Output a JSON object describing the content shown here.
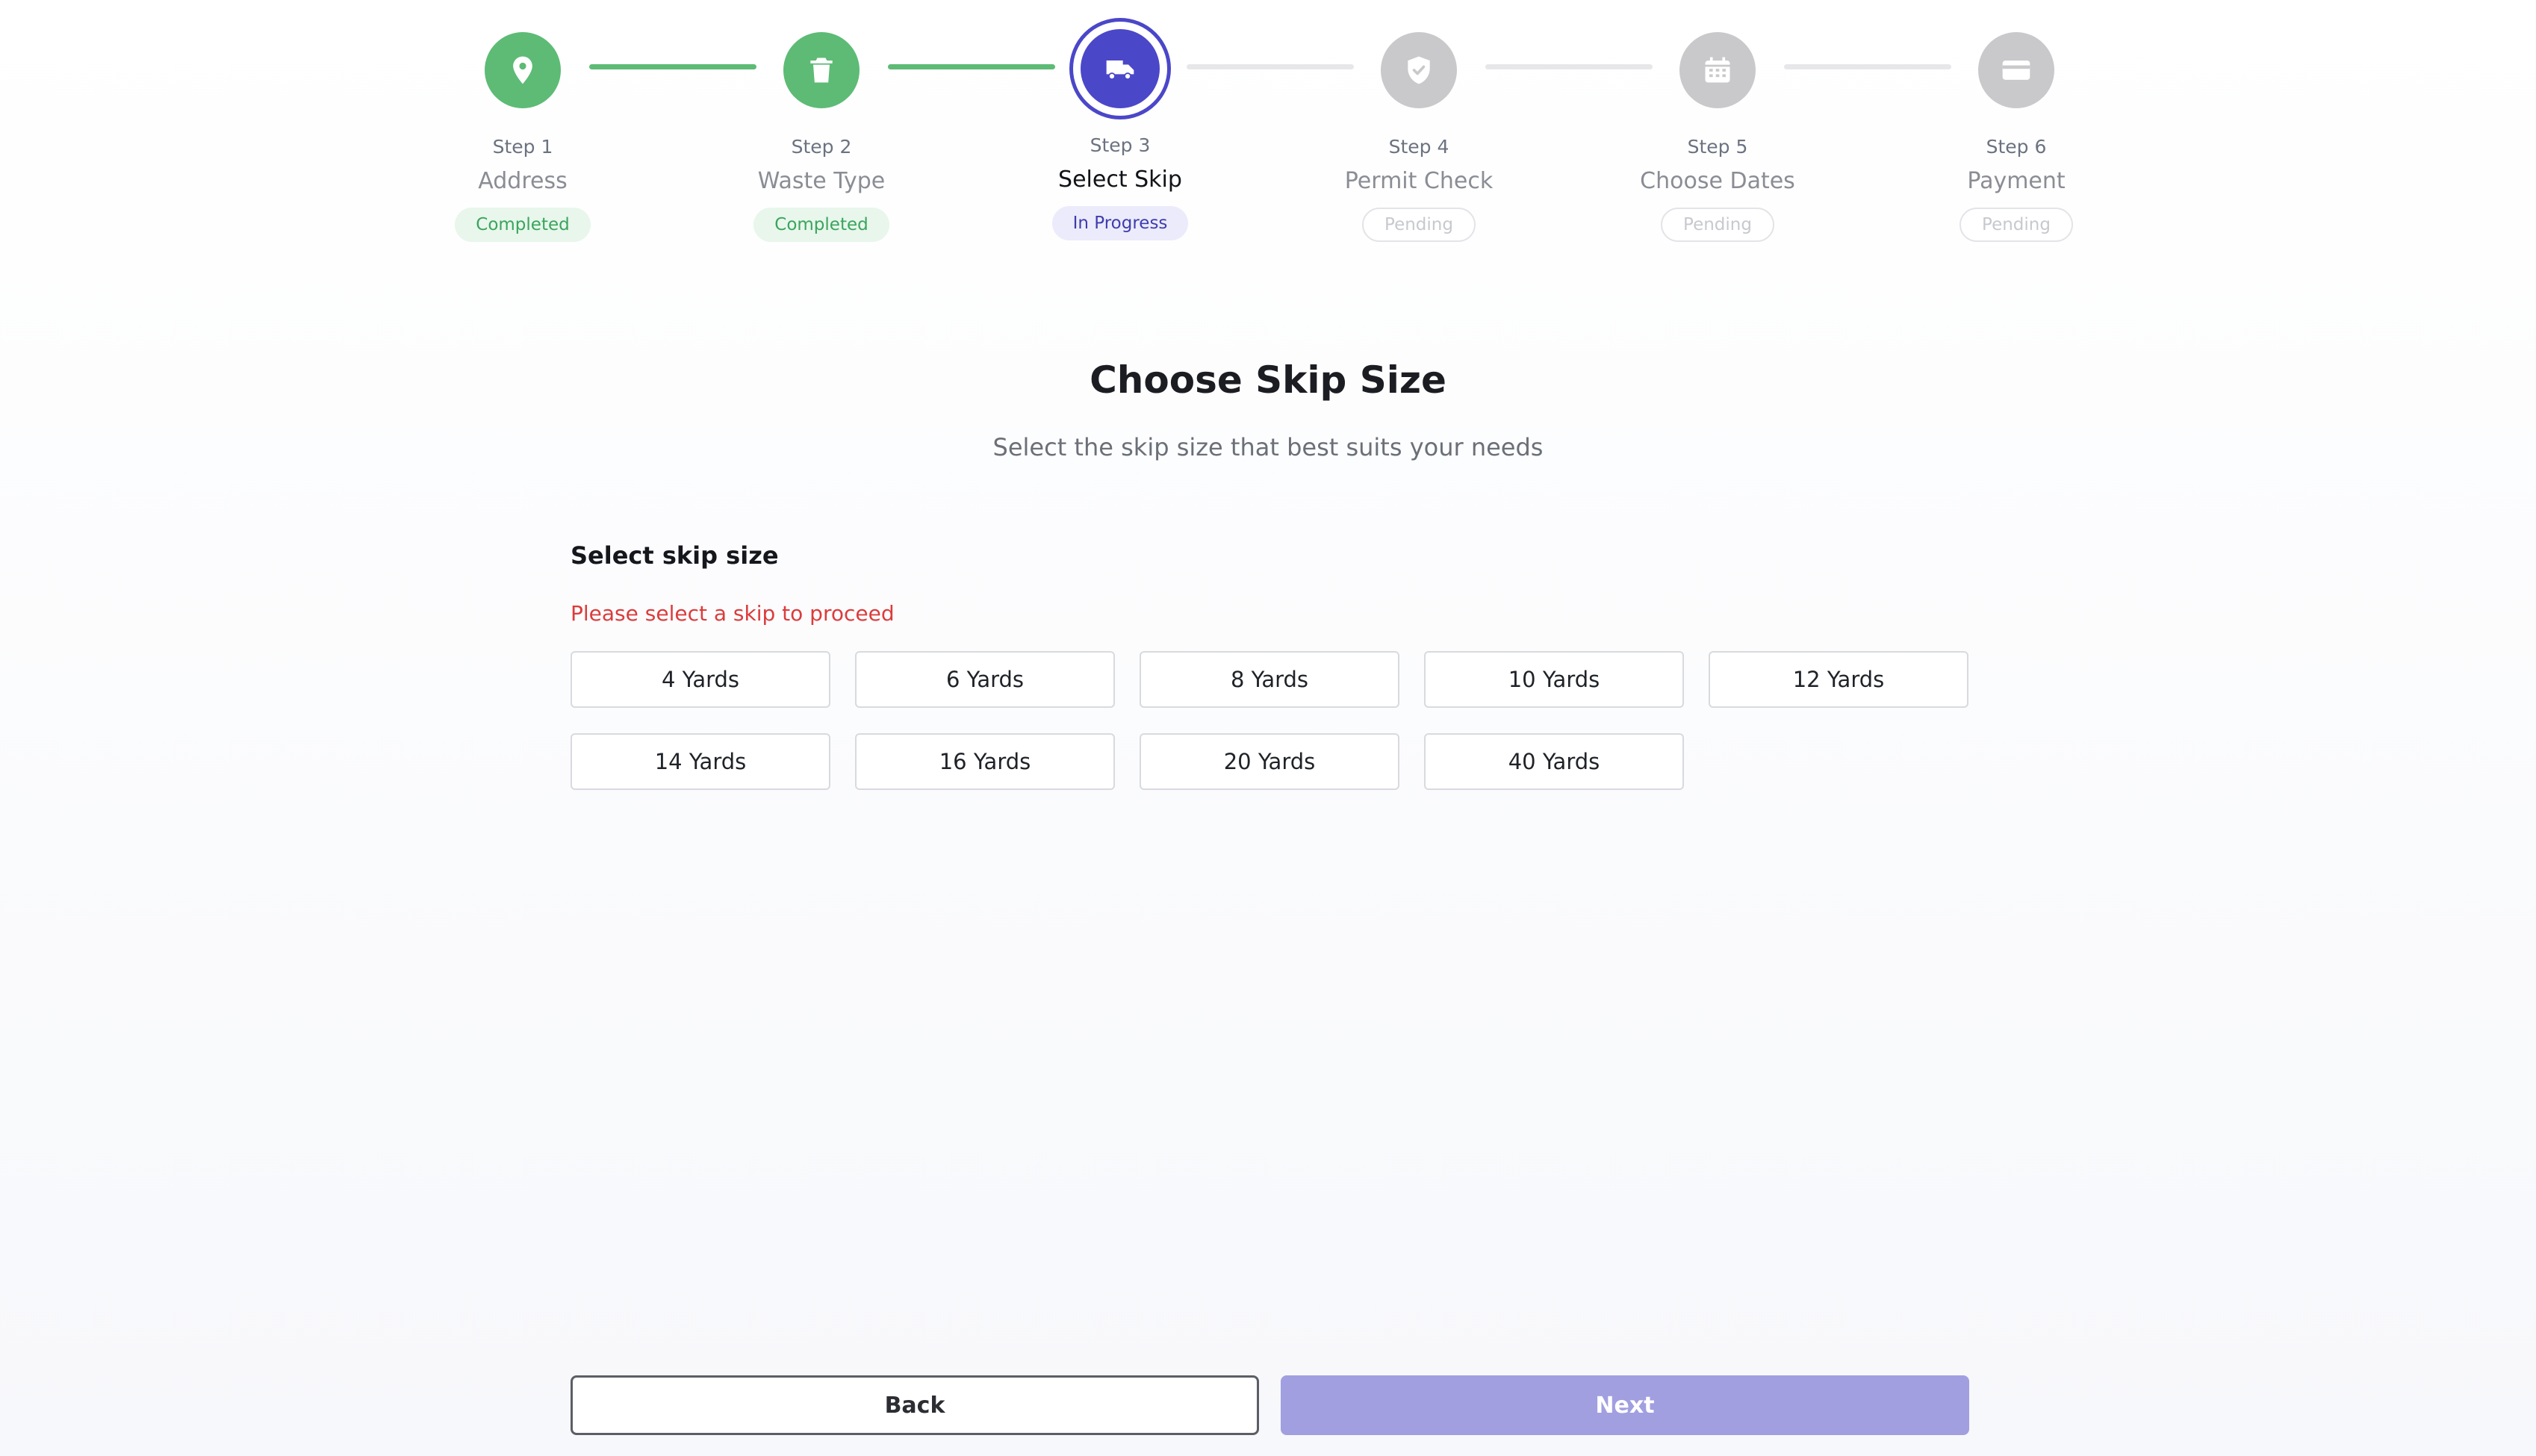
{
  "stepper": {
    "steps": [
      {
        "number": "Step 1",
        "name": "Address",
        "status": "Completed",
        "state": "completed",
        "icon": "map-pin-icon"
      },
      {
        "number": "Step 2",
        "name": "Waste Type",
        "status": "Completed",
        "state": "completed",
        "icon": "trash-icon"
      },
      {
        "number": "Step 3",
        "name": "Select Skip",
        "status": "In Progress",
        "state": "current",
        "icon": "truck-icon"
      },
      {
        "number": "Step 4",
        "name": "Permit Check",
        "status": "Pending",
        "state": "pending",
        "icon": "shield-check-icon"
      },
      {
        "number": "Step 5",
        "name": "Choose Dates",
        "status": "Pending",
        "state": "pending",
        "icon": "calendar-icon"
      },
      {
        "number": "Step 6",
        "name": "Payment",
        "status": "Pending",
        "state": "pending",
        "icon": "credit-card-icon"
      }
    ]
  },
  "header": {
    "title": "Choose Skip Size",
    "subtitle": "Select the skip size that best suits your needs"
  },
  "skip_selection": {
    "label": "Select skip size",
    "error": "Please select a skip to proceed",
    "options": [
      "4 Yards",
      "6 Yards",
      "8 Yards",
      "10 Yards",
      "12 Yards",
      "14 Yards",
      "16 Yards",
      "20 Yards",
      "40 Yards"
    ]
  },
  "footer": {
    "back_label": "Back",
    "next_label": "Next"
  },
  "colors": {
    "completed": "#5dbb75",
    "current": "#4b47c9",
    "pending": "#c9c9cc",
    "error": "#dc3c3c",
    "next_disabled": "#a19fe0"
  }
}
